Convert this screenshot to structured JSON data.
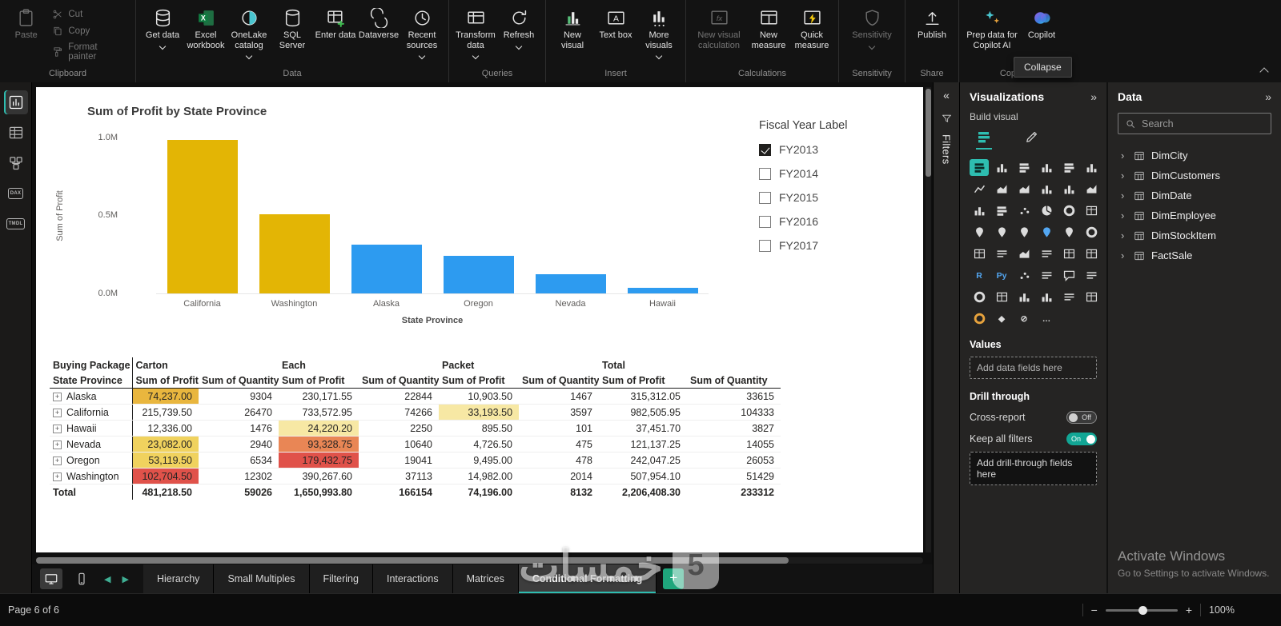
{
  "app": {
    "collapse_tooltip": "Collapse"
  },
  "ribbon": {
    "clipboard": {
      "label": "Clipboard",
      "paste": "Paste",
      "cut": "Cut",
      "copy": "Copy",
      "format_painter": "Format painter"
    },
    "data": {
      "label": "Data",
      "get_data": "Get data",
      "excel": "Excel workbook",
      "onelake": "OneLake catalog",
      "sql": "SQL Server",
      "enter_data": "Enter data",
      "dataverse": "Dataverse",
      "recent": "Recent sources"
    },
    "queries": {
      "label": "Queries",
      "transform": "Transform data",
      "refresh": "Refresh"
    },
    "insert": {
      "label": "Insert",
      "new_visual": "New visual",
      "text_box": "Text box",
      "more_visuals": "More visuals"
    },
    "calculations": {
      "label": "Calculations",
      "new_visual_calculation": "New visual calculation",
      "new_measure": "New measure",
      "quick_measure": "Quick measure"
    },
    "sensitivity": {
      "label": "Sensitivity",
      "button": "Sensitivity"
    },
    "share": {
      "label": "Share",
      "publish": "Publish"
    },
    "copilot": {
      "label": "Copilot",
      "prep": "Prep data for Copilot AI",
      "copilot": "Copilot"
    }
  },
  "left_rail": {
    "dax_badge": "DAX",
    "tmdl_badge": "TMDL"
  },
  "chart_data": {
    "type": "bar",
    "title": "Sum of Profit by State Province",
    "categories": [
      "California",
      "Washington",
      "Alaska",
      "Oregon",
      "Nevada",
      "Hawaii"
    ],
    "values": [
      982506,
      507954,
      315312,
      242047,
      121137,
      37452
    ],
    "colors": [
      "#E3B505",
      "#E3B505",
      "#2D9BF0",
      "#2D9BF0",
      "#2D9BF0",
      "#2D9BF0"
    ],
    "xlabel": "State Province",
    "ylabel": "Sum of Profit",
    "ylim": [
      0,
      1000000
    ],
    "yticks": [
      "1.0M",
      "0.5M",
      "0.0M"
    ],
    "grid": false,
    "legend": false
  },
  "slicer": {
    "title": "Fiscal Year Label",
    "items": [
      {
        "label": "FY2013",
        "checked": true
      },
      {
        "label": "FY2014",
        "checked": false
      },
      {
        "label": "FY2015",
        "checked": false
      },
      {
        "label": "FY2016",
        "checked": false
      },
      {
        "label": "FY2017",
        "checked": false
      }
    ]
  },
  "matrix": {
    "group_headers": [
      "Buying Package",
      "Carton",
      "Each",
      "Packet",
      "Total"
    ],
    "row_header": "State Province",
    "measure_headers": [
      "Sum of Profit",
      "Sum of Quantity"
    ],
    "rows": [
      [
        "Alaska",
        "74,237.00",
        "9304",
        "230,171.55",
        "22844",
        "10,903.50",
        "1467",
        "315,312.05",
        "33615"
      ],
      [
        "California",
        "215,739.50",
        "26470",
        "733,572.95",
        "74266",
        "33,193.50",
        "3597",
        "982,505.95",
        "104333"
      ],
      [
        "Hawaii",
        "12,336.00",
        "1476",
        "24,220.20",
        "2250",
        "895.50",
        "101",
        "37,451.70",
        "3827"
      ],
      [
        "Nevada",
        "23,082.00",
        "2940",
        "93,328.75",
        "10640",
        "4,726.50",
        "475",
        "121,137.25",
        "14055"
      ],
      [
        "Oregon",
        "53,119.50",
        "6534",
        "179,432.75",
        "19041",
        "9,495.00",
        "478",
        "242,047.25",
        "26053"
      ],
      [
        "Washington",
        "102,704.50",
        "12302",
        "390,267.60",
        "37113",
        "14,982.00",
        "2014",
        "507,954.10",
        "51429"
      ]
    ],
    "total": [
      "Total",
      "481,218.50",
      "59026",
      "1,650,993.80",
      "166154",
      "74,196.00",
      "8132",
      "2,206,408.30",
      "233312"
    ],
    "conditional_colors": {
      "amber": "#E9B63E",
      "yellow": "#F0D25E",
      "pale_yellow": "#F7E8A4",
      "orange": "#E98655",
      "red": "#E0524A"
    }
  },
  "visualizations": {
    "title": "Visualizations",
    "build_visual": "Build visual",
    "values_label": "Values",
    "add_fields": "Add data fields here",
    "drill_through": "Drill through",
    "cross_report": "Cross-report",
    "cross_report_state": "Off",
    "keep_all_filters": "Keep all filters",
    "keep_all_filters_state": "On",
    "add_drill": "Add drill-through fields here",
    "gallery": [
      {
        "name": "stacked-bar-chart",
        "type": "hbars",
        "active": true
      },
      {
        "name": "stacked-column-chart",
        "type": "vbars"
      },
      {
        "name": "clustered-bar-chart",
        "type": "hbars"
      },
      {
        "name": "clustered-column-chart",
        "type": "vbars"
      },
      {
        "name": "100-stacked-bar-chart",
        "type": "hbars"
      },
      {
        "name": "100-stacked-column-chart",
        "type": "vbars"
      },
      {
        "name": "line-chart",
        "type": "line"
      },
      {
        "name": "area-chart",
        "type": "area"
      },
      {
        "name": "stacked-area-chart",
        "type": "area"
      },
      {
        "name": "line-and-stacked-column-chart",
        "type": "vbars"
      },
      {
        "name": "line-and-clustered-column-chart",
        "type": "vbars"
      },
      {
        "name": "ribbon-chart",
        "type": "area"
      },
      {
        "name": "waterfall-chart",
        "type": "vbars"
      },
      {
        "name": "funnel-chart",
        "type": "hbars"
      },
      {
        "name": "scatter-chart",
        "type": "dot"
      },
      {
        "name": "pie-chart",
        "type": "pie"
      },
      {
        "name": "donut-chart",
        "type": "donut"
      },
      {
        "name": "treemap",
        "type": "grid"
      },
      {
        "name": "map",
        "type": "map"
      },
      {
        "name": "filled-map",
        "type": "map"
      },
      {
        "name": "shape-map",
        "type": "map"
      },
      {
        "name": "azure-map",
        "type": "map",
        "style": "blue"
      },
      {
        "name": "arcgis-map",
        "type": "map"
      },
      {
        "name": "gauge",
        "type": "donut"
      },
      {
        "name": "card",
        "type": "grid"
      },
      {
        "name": "multi-row-card",
        "type": "lines"
      },
      {
        "name": "kpi",
        "type": "area"
      },
      {
        "name": "slicer",
        "type": "lines"
      },
      {
        "name": "table",
        "type": "grid"
      },
      {
        "name": "matrix",
        "type": "grid"
      },
      {
        "name": "r-script-visual",
        "text": "R",
        "style": "blue"
      },
      {
        "name": "python-visual",
        "text": "Py",
        "style": "blue"
      },
      {
        "name": "key-influencers",
        "type": "dot"
      },
      {
        "name": "decomposition-tree",
        "type": "lines"
      },
      {
        "name": "qna",
        "type": "bubble"
      },
      {
        "name": "smart-narrative",
        "type": "lines"
      },
      {
        "name": "metrics",
        "type": "donut"
      },
      {
        "name": "paginated-report",
        "type": "grid"
      },
      {
        "name": "power-apps",
        "type": "vbars"
      },
      {
        "name": "power-automate",
        "type": "vbars"
      },
      {
        "name": "button-slicer",
        "type": "lines"
      },
      {
        "name": "image",
        "type": "grid"
      },
      {
        "name": "scorecard",
        "type": "donut",
        "style": "gold"
      },
      {
        "name": "shape",
        "text": "◆"
      },
      {
        "name": "blank",
        "text": "⊘"
      },
      {
        "name": "more-options",
        "text": "…"
      }
    ]
  },
  "filters_panel": {
    "title": "Filters"
  },
  "data_panel": {
    "title": "Data",
    "search_placeholder": "Search",
    "tables": [
      "DimCity",
      "DimCustomers",
      "DimDate",
      "DimEmployee",
      "DimStockItem",
      "FactSale"
    ]
  },
  "pages": {
    "tabs": [
      "Hierarchy",
      "Small Multiples",
      "Filtering",
      "Interactions",
      "Matrices",
      "Conditional Formatting"
    ],
    "active": "Conditional Formatting"
  },
  "statusbar": {
    "page_indicator": "Page 6 of 6",
    "zoom": "100%"
  },
  "watermarks": {
    "logo_text": "خمسات",
    "logo_mark": "5",
    "activate_line1": "Activate Windows",
    "activate_line2": "Go to Settings to activate Windows."
  }
}
